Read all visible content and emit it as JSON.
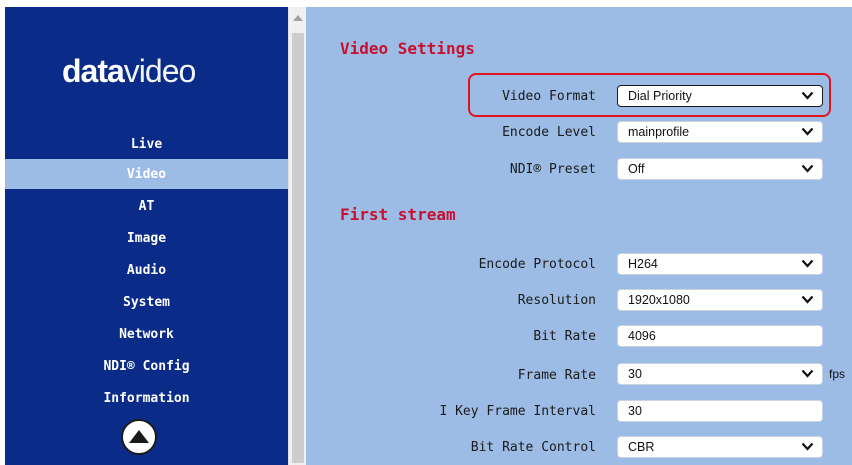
{
  "logo": {
    "part1": "data",
    "part2": "video"
  },
  "nav": [
    "Live",
    "Video",
    "AT",
    "Image",
    "Audio",
    "System",
    "Network",
    "NDI® Config",
    "Information"
  ],
  "active_nav": "Video",
  "sections": {
    "video_settings": {
      "title": "Video Settings",
      "video_format": {
        "label": "Video Format",
        "value": "Dial Priority"
      },
      "encode_level": {
        "label": "Encode Level",
        "value": "mainprofile"
      },
      "ndi_preset": {
        "label": "NDI® Preset",
        "value": "Off"
      }
    },
    "first_stream": {
      "title": "First stream",
      "encode_protocol": {
        "label": "Encode Protocol",
        "value": "H264"
      },
      "resolution": {
        "label": "Resolution",
        "value": "1920x1080"
      },
      "bit_rate": {
        "label": "Bit Rate",
        "value": "4096"
      },
      "frame_rate": {
        "label": "Frame Rate",
        "value": "30",
        "unit": "fps"
      },
      "i_key_frame_interval": {
        "label": "I Key Frame Interval",
        "value": "30"
      },
      "bit_rate_control": {
        "label": "Bit Rate Control",
        "value": "CBR"
      }
    }
  },
  "colors": {
    "sidebar": "#0a2c88",
    "content": "#9dbce5",
    "section_title": "#c8102e",
    "highlight": "#e0151b"
  },
  "icons": {
    "scroll_top": "up-arrow-circle-icon",
    "dropdown": "chevron-down-icon"
  }
}
